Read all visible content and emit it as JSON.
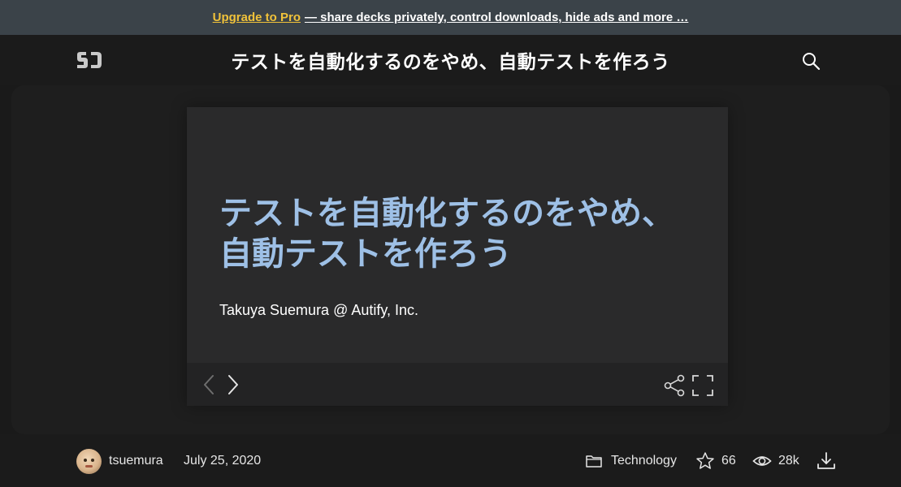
{
  "promo": {
    "link_label": "Upgrade to Pro",
    "text": "— share decks privately, control downloads, hide ads and more …"
  },
  "header": {
    "logo_text": "SD",
    "deck_title": "テストを自動化するのをやめ、自動テストを作ろう",
    "search_icon": "search-icon"
  },
  "slide": {
    "title_line1": "テストを自動化するのをやめ、",
    "title_line2": "自動テストを作ろう",
    "author": "Takuya Suemura @ Autify, Inc.",
    "title_color": "#9ec0e6"
  },
  "controls": {
    "prev_icon": "chevron-left-icon",
    "next_icon": "chevron-right-icon",
    "share_icon": "share-icon",
    "fullscreen_icon": "fullscreen-icon"
  },
  "meta": {
    "username": "tsuemura",
    "date": "July 25, 2020",
    "category": "Technology",
    "stars": "66",
    "views": "28k"
  },
  "colors": {
    "promo_bg": "#3b4349",
    "accent": "#f0c23a",
    "page_bg": "#1a1a1a"
  }
}
